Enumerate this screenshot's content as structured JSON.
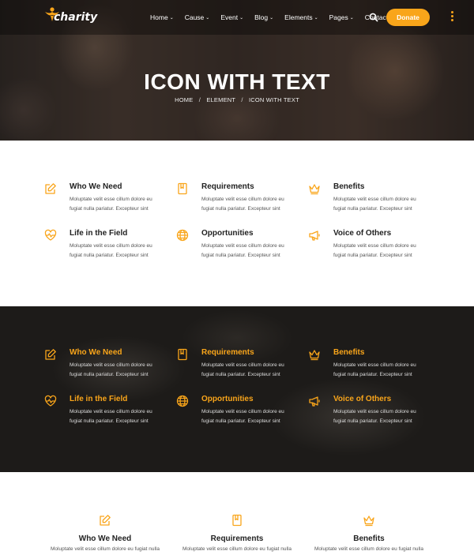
{
  "brand": {
    "logo_text": "charity",
    "accent": "#f9a51a"
  },
  "nav": {
    "items": [
      {
        "label": "Home",
        "has_dropdown": true
      },
      {
        "label": "Cause",
        "has_dropdown": true
      },
      {
        "label": "Event",
        "has_dropdown": true
      },
      {
        "label": "Blog",
        "has_dropdown": true
      },
      {
        "label": "Elements",
        "has_dropdown": true
      },
      {
        "label": "Pages",
        "has_dropdown": true
      },
      {
        "label": "Contact",
        "has_dropdown": false
      }
    ],
    "chevron": "⌄",
    "donate_label": "Donate"
  },
  "hero": {
    "title": "ICON WITH TEXT",
    "breadcrumb": {
      "home": "HOME",
      "element": "ELEMENT",
      "current": "ICON WITH TEXT",
      "separator": "/"
    }
  },
  "features": [
    {
      "title": "Who We Need",
      "icon": "edit-icon",
      "desc": "Moluptate velit esse cillum dolore eu fugiat nulla pariatur. Excepteur sint"
    },
    {
      "title": "Requirements",
      "icon": "book-icon",
      "desc": "Moluptate velit esse cillum dolore eu fugiat nulla pariatur. Excepteur sint"
    },
    {
      "title": "Benefits",
      "icon": "crown-icon",
      "desc": "Moluptate velit esse cillum dolore eu fugiat nulla pariatur. Excepteur sint"
    },
    {
      "title": "Life in the Field",
      "icon": "heartbeat-icon",
      "desc": "Moluptate velit esse cillum dolore eu fugiat nulla pariatur. Excepteur sint"
    },
    {
      "title": "Opportunities",
      "icon": "globe-icon",
      "desc": "Moluptate velit esse cillum dolore eu fugiat nulla pariatur. Excepteur sint"
    },
    {
      "title": "Voice of Others",
      "icon": "megaphone-icon",
      "desc": "Moluptate velit esse cillum dolore eu fugiat nulla pariatur. Excepteur sint"
    }
  ],
  "centered_features": [
    {
      "title": "Who We Need",
      "icon": "edit-icon",
      "desc": "Moluptate velit esse cillum dolore eu fugiat nulla"
    },
    {
      "title": "Requirements",
      "icon": "book-icon",
      "desc": "Moluptate velit esse cillum dolore eu fugiat nulla"
    },
    {
      "title": "Benefits",
      "icon": "crown-icon",
      "desc": "Moluptate velit esse cillum dolore eu fugiat nulla"
    }
  ]
}
